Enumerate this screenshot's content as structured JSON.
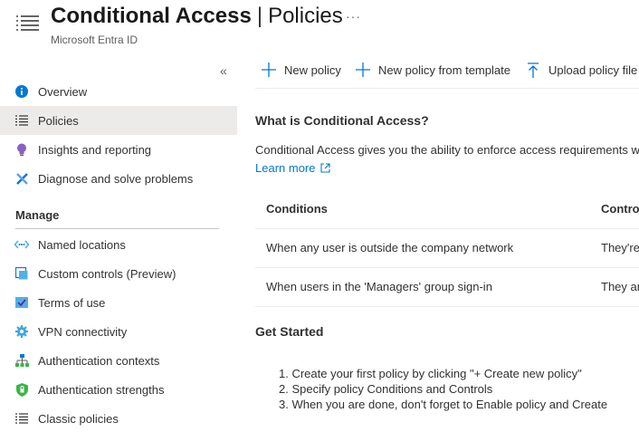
{
  "header": {
    "title_main": "Conditional Access",
    "title_sep": "|",
    "title_sub": "Policies",
    "ellipsis": "···",
    "subtitle": "Microsoft Entra ID"
  },
  "sidebar": {
    "collapse": "«",
    "items": [
      {
        "label": "Overview",
        "icon": "info-icon"
      },
      {
        "label": "Policies",
        "icon": "list-icon",
        "selected": true
      },
      {
        "label": "Insights and reporting",
        "icon": "lightbulb-icon"
      },
      {
        "label": "Diagnose and solve problems",
        "icon": "wrench-icon"
      }
    ],
    "manage_label": "Manage",
    "manage_items": [
      {
        "label": "Named locations",
        "icon": "network-icon"
      },
      {
        "label": "Custom controls (Preview)",
        "icon": "custom-controls-icon"
      },
      {
        "label": "Terms of use",
        "icon": "checkmark-doc-icon"
      },
      {
        "label": "VPN connectivity",
        "icon": "gear-icon"
      },
      {
        "label": "Authentication contexts",
        "icon": "hierarchy-icon"
      },
      {
        "label": "Authentication strengths",
        "icon": "shield-icon"
      },
      {
        "label": "Classic policies",
        "icon": "list-icon"
      }
    ]
  },
  "toolbar": {
    "new_policy": "New policy",
    "new_from_template": "New policy from template",
    "upload": "Upload policy file"
  },
  "main": {
    "what_title": "What is Conditional Access?",
    "description": "Conditional Access gives you the ability to enforce access requirements wh",
    "learn_more": "Learn more",
    "table": {
      "headers": [
        "Conditions",
        "Controls"
      ],
      "rows": [
        [
          "When any user is outside the company network",
          "They're"
        ],
        [
          "When users in the 'Managers' group sign-in",
          "They ar"
        ]
      ]
    },
    "get_started_title": "Get Started",
    "steps": [
      "1. Create your first policy by clicking \"+ Create new policy\"",
      "2. Specify policy Conditions and Controls",
      "3. When you are done, don't forget to Enable policy and Create"
    ]
  },
  "colors": {
    "accent": "#0078d4",
    "selected_bg": "#edebe9"
  }
}
